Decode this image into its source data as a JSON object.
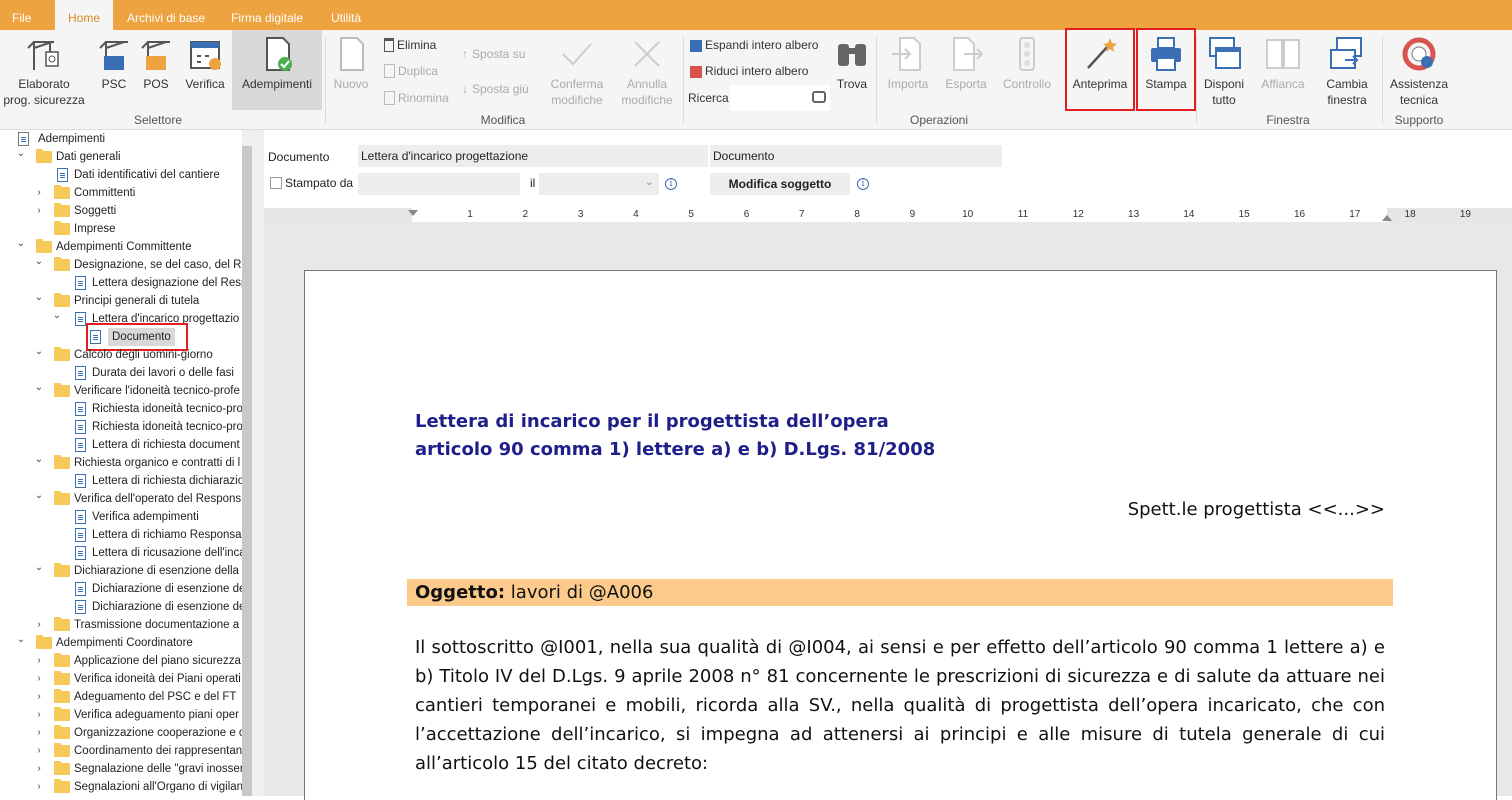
{
  "menu": {
    "tabs": [
      "File",
      "Home",
      "Archivi di base",
      "Firma digitale",
      "Utilità"
    ],
    "active": "Home"
  },
  "ribbon": {
    "selettore": {
      "group_label": "Selettore",
      "elaborato": "Elaborato\nprog. sicurezza",
      "psc": "PSC",
      "pos": "POS",
      "verifica": "Verifica",
      "adempimenti": "Adempimenti"
    },
    "modifica": {
      "group_label": "Modifica",
      "nuovo": "Nuovo",
      "elimina": "Elimina",
      "duplica": "Duplica",
      "rinomina": "Rinomina",
      "sposta_su": "Sposta su",
      "sposta_giu": "Sposta giù",
      "conferma": "Conferma\nmodifiche",
      "annulla": "Annulla\nmodifiche"
    },
    "operazioni": {
      "group_label": "Operazioni",
      "espandi": "Espandi intero albero",
      "riduci": "Riduci intero albero",
      "ricerca": "Ricerca",
      "trova": "Trova",
      "importa": "Importa",
      "esporta": "Esporta",
      "controllo": "Controllo",
      "anteprima": "Anteprima",
      "stampa": "Stampa"
    },
    "finestra": {
      "group_label": "Finestra",
      "disponi": "Disponi\ntutto",
      "affianca": "Affianca",
      "cambia": "Cambia\nfinestra"
    },
    "supporto": {
      "group_label": "Supporto",
      "assistenza": "Assistenza\ntecnica"
    }
  },
  "tree": {
    "items": [
      {
        "label": "Adempimenti",
        "level": 0,
        "type": "root",
        "chev": ""
      },
      {
        "label": "Dati generali",
        "level": 1,
        "type": "folder",
        "chev": "down"
      },
      {
        "label": "Dati identificativi del cantiere",
        "level": 2,
        "type": "doc",
        "chev": ""
      },
      {
        "label": "Committenti",
        "level": 2,
        "type": "folder",
        "chev": "right"
      },
      {
        "label": "Soggetti",
        "level": 2,
        "type": "folder",
        "chev": "right"
      },
      {
        "label": "Imprese",
        "level": 2,
        "type": "folder",
        "chev": ""
      },
      {
        "label": "Adempimenti Committente",
        "level": 1,
        "type": "folder",
        "chev": "down"
      },
      {
        "label": "Designazione, se del caso, del Re",
        "level": 2,
        "type": "folder",
        "chev": "down"
      },
      {
        "label": "Lettera designazione del Resp",
        "level": 3,
        "type": "doc",
        "chev": ""
      },
      {
        "label": "Principi generali di tutela",
        "level": 2,
        "type": "folder",
        "chev": "down"
      },
      {
        "label": "Lettera d'incarico progettazio",
        "level": 3,
        "type": "doc",
        "chev": "down"
      },
      {
        "label": "Documento",
        "level": 4,
        "type": "edit",
        "chev": "",
        "selected": true
      },
      {
        "label": "Calcolo degli uomini-giorno",
        "level": 2,
        "type": "folder",
        "chev": "down"
      },
      {
        "label": "Durata dei lavori o delle fasi",
        "level": 3,
        "type": "doc",
        "chev": ""
      },
      {
        "label": "Verificare l'idoneità tecnico-profe",
        "level": 2,
        "type": "folder",
        "chev": "down"
      },
      {
        "label": "Richiesta idoneità tecnico-pro",
        "level": 3,
        "type": "doc",
        "chev": ""
      },
      {
        "label": "Richiesta idoneità tecnico-pro",
        "level": 3,
        "type": "doc",
        "chev": ""
      },
      {
        "label": "Lettera di richiesta document",
        "level": 3,
        "type": "doc",
        "chev": ""
      },
      {
        "label": "Richiesta organico e contratti di l",
        "level": 2,
        "type": "folder",
        "chev": "down"
      },
      {
        "label": "Lettera di richiesta dichiarazio",
        "level": 3,
        "type": "doc",
        "chev": ""
      },
      {
        "label": "Verifica dell'operato del Respons",
        "level": 2,
        "type": "folder",
        "chev": "down"
      },
      {
        "label": "Verifica adempimenti",
        "level": 3,
        "type": "doc",
        "chev": ""
      },
      {
        "label": "Lettera di richiamo Responsa",
        "level": 3,
        "type": "doc",
        "chev": ""
      },
      {
        "label": "Lettera di ricusazione dell'inca",
        "level": 3,
        "type": "doc",
        "chev": ""
      },
      {
        "label": "Dichiarazione di esenzione della",
        "level": 2,
        "type": "folder",
        "chev": "down"
      },
      {
        "label": "Dichiarazione di esenzione de",
        "level": 3,
        "type": "doc",
        "chev": ""
      },
      {
        "label": "Dichiarazione di esenzione de",
        "level": 3,
        "type": "doc",
        "chev": ""
      },
      {
        "label": "Trasmissione documentazione a",
        "level": 2,
        "type": "folder",
        "chev": "right"
      },
      {
        "label": "Adempimenti Coordinatore",
        "level": 1,
        "type": "folder",
        "chev": "down"
      },
      {
        "label": "Applicazione del piano sicurezza",
        "level": 2,
        "type": "folder",
        "chev": "right"
      },
      {
        "label": "Verifica idoneità dei Piani operati",
        "level": 2,
        "type": "folder",
        "chev": "right"
      },
      {
        "label": "Adeguamento del PSC e del FT",
        "level": 2,
        "type": "folder",
        "chev": "right"
      },
      {
        "label": "Verifica adeguamento piani oper",
        "level": 2,
        "type": "folder",
        "chev": "right"
      },
      {
        "label": "Organizzazione cooperazione e c",
        "level": 2,
        "type": "folder",
        "chev": "right"
      },
      {
        "label": "Coordinamento dei rappresentan",
        "level": 2,
        "type": "folder",
        "chev": "right"
      },
      {
        "label": "Segnalazione delle \"gravi inosser",
        "level": 2,
        "type": "folder",
        "chev": "right"
      },
      {
        "label": "Segnalazioni all'Organo di vigilan",
        "level": 2,
        "type": "folder",
        "chev": "right"
      }
    ]
  },
  "form": {
    "documento_label": "Documento",
    "documento_value": "Lettera d'incarico progettazione",
    "tipo_value": "Documento",
    "stampato_label": "Stampato da",
    "stampato_value": "",
    "il_label": "il",
    "il_value": "",
    "modifica_soggetto": "Modifica soggetto"
  },
  "ruler": {
    "numbers": [
      "1",
      "2",
      "3",
      "4",
      "5",
      "6",
      "7",
      "8",
      "9",
      "10",
      "11",
      "12",
      "13",
      "14",
      "15",
      "16",
      "17",
      "18",
      "19"
    ]
  },
  "document": {
    "title_line1": "Lettera di incarico per il progettista dell’opera",
    "title_line2": "articolo 90 comma 1) lettere a) e b) D.Lgs. 81/2008",
    "recipient": "Spett.le progettista <<...>>",
    "oggetto_label": "Oggetto:",
    "oggetto_value": " lavori di @A006",
    "body": "Il sottoscritto @I001, nella sua qualità di @I004, ai sensi e per effetto dell’articolo 90 comma 1 lettere a) e b) Titolo IV del D.Lgs. 9 aprile 2008 n° 81 concernente le prescrizioni di sicurezza e di salute da attuare nei cantieri temporanei e mobili, ricorda alla SV., nella qualità di progettista dell’opera incaricato, che con l’accettazione dell’incarico, si impegna ad attenersi ai principi e alle misure di tutela generale di cui all’articolo 15 del citato decreto:"
  },
  "colors": {
    "menubar": "#EDA33F",
    "title_blue": "#1F1F8A",
    "oggetto_bg": "#FCCB8C",
    "highlight_red": "#E02020"
  }
}
